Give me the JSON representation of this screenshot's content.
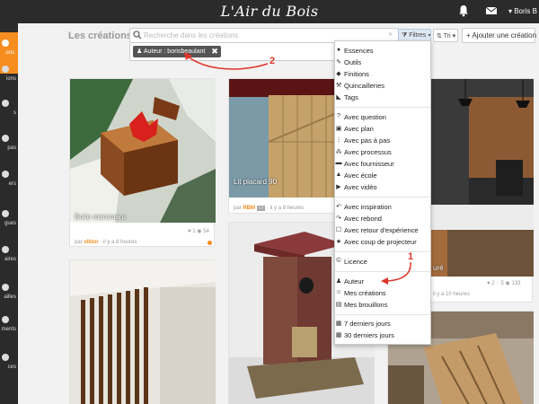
{
  "topbar": {
    "logo": "L'Air du Bois",
    "user_name": "Boris B"
  },
  "sidebar": {
    "items": [
      {
        "label": "ons",
        "active": true
      },
      {
        "label": "ions"
      },
      {
        "label": "s"
      },
      {
        "label": "pas"
      },
      {
        "label": "ers"
      },
      {
        "label": "gues"
      },
      {
        "label": "aires"
      },
      {
        "label": "ailles"
      },
      {
        "label": "ments"
      },
      {
        "label": "ces"
      }
    ]
  },
  "header": {
    "title": "Les créations",
    "search_placeholder": "Recherche dans les créations",
    "clear_icon": "×",
    "filter_label": "Filtres",
    "sort_label": "Tri",
    "add_label": "+ Ajouter une création"
  },
  "active_filter": {
    "label": "Auteur : borisbeaulant",
    "close": "✖"
  },
  "annotations": {
    "one": "1",
    "two": "2"
  },
  "cards": [
    {
      "title": "Boite marumaru",
      "author_prefix": "par",
      "author": "viktor",
      "time": "il y a 8 heures",
      "likes": "1",
      "views": "54"
    },
    {
      "title": "Lit placard 90",
      "author_prefix": "par",
      "author": "RBM",
      "time": "il y a 8 heures"
    },
    {
      "title": "",
      "author_prefix": "",
      "author": "",
      "time": ""
    },
    {
      "title": "uré",
      "author_prefix": "",
      "author": "",
      "time": "il y a 10 heures",
      "likes": "2",
      "comments": "5",
      "views": "133"
    },
    {
      "title": "",
      "author_prefix": "",
      "author": "",
      "time": ""
    },
    {
      "title": "",
      "author_prefix": "",
      "author": "",
      "time": ""
    }
  ],
  "filter_menu": {
    "groups": [
      [
        {
          "icon": "circle-icon",
          "glyph": "●",
          "label": "Essences"
        },
        {
          "icon": "wrench-icon",
          "glyph": "✎",
          "label": "Outils"
        },
        {
          "icon": "drop-icon",
          "glyph": "◆",
          "label": "Finitions"
        },
        {
          "icon": "hammer-icon",
          "glyph": "⚒",
          "label": "Quincailleries"
        },
        {
          "icon": "tag-icon",
          "glyph": "◣",
          "label": "Tags"
        }
      ],
      [
        {
          "icon": "question-icon",
          "glyph": "?",
          "label": "Avec question"
        },
        {
          "icon": "plan-icon",
          "glyph": "▣",
          "label": "Avec plan"
        },
        {
          "icon": "steps-icon",
          "glyph": "⋮",
          "label": "Avec pas à pas"
        },
        {
          "icon": "process-icon",
          "glyph": "⁂",
          "label": "Avec processus"
        },
        {
          "icon": "truck-icon",
          "glyph": "▬",
          "label": "Avec fournisseur"
        },
        {
          "icon": "school-icon",
          "glyph": "▲",
          "label": "Avec école"
        },
        {
          "icon": "video-icon",
          "glyph": "▶",
          "label": "Avec vidéo"
        }
      ],
      [
        {
          "icon": "inspiration-icon",
          "glyph": "↶",
          "label": "Avec inspiration"
        },
        {
          "icon": "rebound-icon",
          "glyph": "↷",
          "label": "Avec rebond"
        },
        {
          "icon": "feedback-icon",
          "glyph": "☐",
          "label": "Avec retour d'expérience"
        },
        {
          "icon": "star-icon",
          "glyph": "★",
          "label": "Avec coup de projecteur"
        }
      ],
      [
        {
          "icon": "license-icon",
          "glyph": "©",
          "label": "Licence"
        }
      ],
      [
        {
          "icon": "author-icon",
          "glyph": "♟",
          "label": "Auteur"
        },
        {
          "icon": "my-creations-icon",
          "glyph": "☺",
          "label": "Mes créations"
        },
        {
          "icon": "drafts-icon",
          "glyph": "▤",
          "label": "Mes brouillons"
        }
      ],
      [
        {
          "icon": "calendar-icon",
          "glyph": "▦",
          "label": "7 derniers jours"
        },
        {
          "icon": "calendar-icon",
          "glyph": "▦",
          "label": "30 derniers jours"
        }
      ]
    ]
  },
  "colors": {
    "accent": "#f58d1f",
    "topbar": "#2b2b2b",
    "annotation": "#e0352b"
  }
}
